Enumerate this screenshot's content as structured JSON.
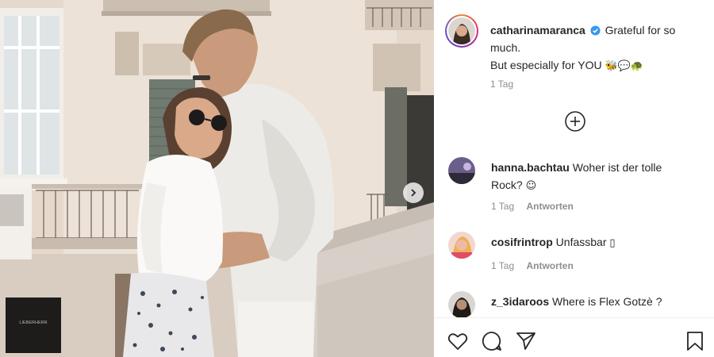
{
  "post": {
    "username": "catharinamaranca",
    "caption_line1": "Grateful for so much.",
    "caption_line2": "But especially for YOU",
    "caption_emojis": "🐝💬🐢",
    "time": "1 Tag"
  },
  "comments": [
    {
      "username": "hanna.bachtau",
      "text": "Woher ist der tolle Rock?",
      "emoji": "☺",
      "time": "1 Tag",
      "reply_label": "Antworten"
    },
    {
      "username": "cosifrintrop",
      "text": "Unfassbar",
      "emoji": "▯",
      "time": "1 Tag",
      "reply_label": "Antworten"
    },
    {
      "username": "z_3idaroos",
      "text": "Where is Flex Gotzè ?",
      "emoji": "",
      "time": "",
      "reply_label": ""
    }
  ],
  "photo": {
    "sign_text": "LIEBERHERR"
  },
  "icons": {
    "next": "chevron-right-icon",
    "load_more": "plus-circle-icon",
    "like": "heart-icon",
    "comment": "comment-icon",
    "share": "paper-plane-icon",
    "save": "bookmark-icon"
  },
  "colors": {
    "verified": "#3897f0",
    "meta_text": "#8e8e8e",
    "text": "#262626"
  }
}
